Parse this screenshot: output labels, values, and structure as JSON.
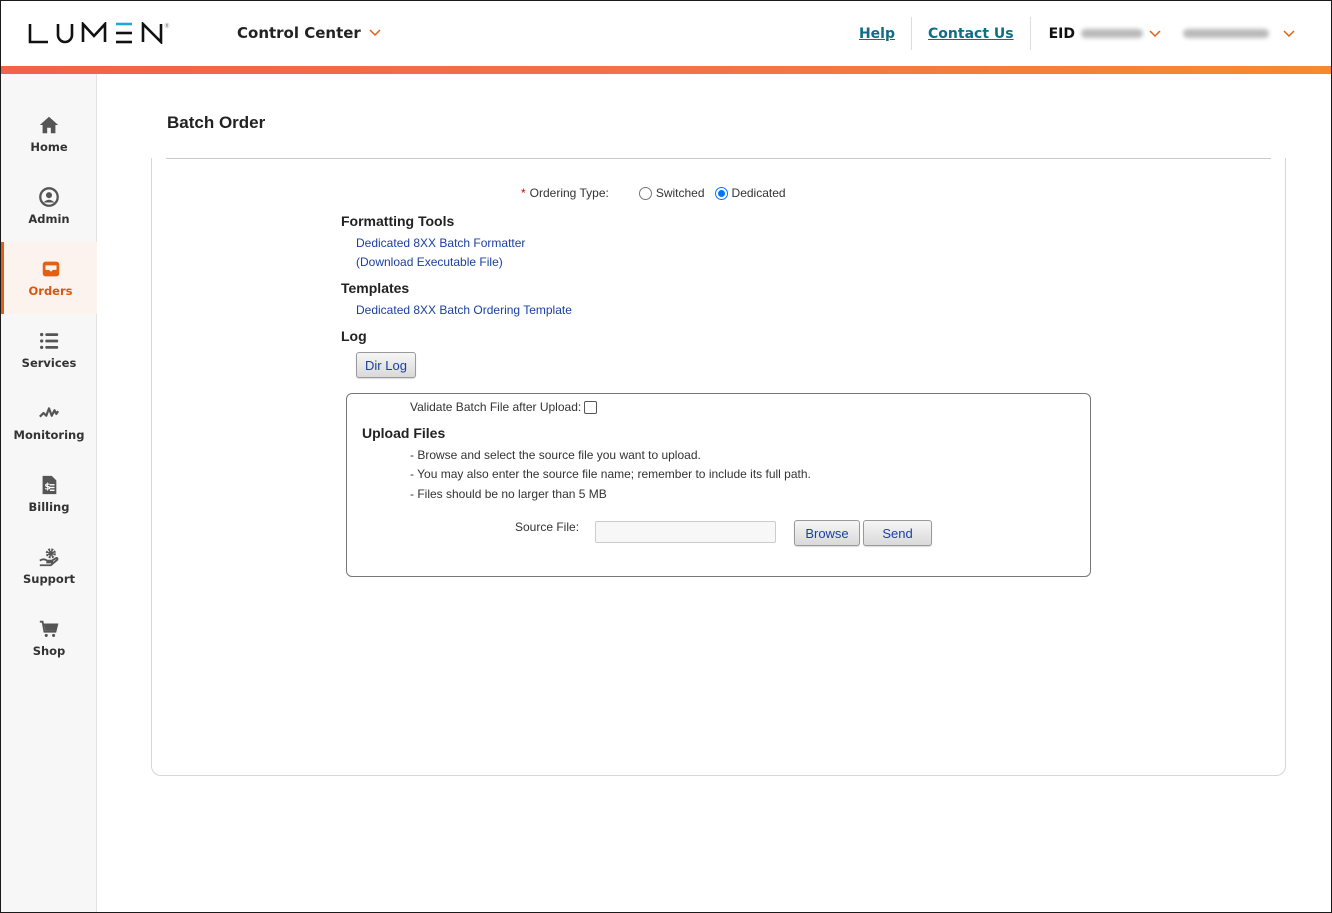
{
  "header": {
    "logo_text": "LUMEN",
    "app_switcher_label": "Control Center",
    "help_label": "Help",
    "contact_label": "Contact Us",
    "eid_label": "EID",
    "eid_value": "[redacted]",
    "user_name": "[redacted]"
  },
  "colors": {
    "accent": "#e35f12",
    "link": "#1a3fa0",
    "header_link": "#0e6e84",
    "gradient_start": "#f4604a",
    "gradient_end": "#f78a31"
  },
  "sidebar": {
    "items": [
      {
        "label": "Home",
        "icon": "home-icon",
        "active": false
      },
      {
        "label": "Admin",
        "icon": "user-circle-icon",
        "active": false
      },
      {
        "label": "Orders",
        "icon": "inbox-tray-icon",
        "active": true
      },
      {
        "label": "Services",
        "icon": "list-icon",
        "active": false
      },
      {
        "label": "Monitoring",
        "icon": "pulse-icon",
        "active": false
      },
      {
        "label": "Billing",
        "icon": "invoice-dollar-icon",
        "active": false
      },
      {
        "label": "Support",
        "icon": "hand-gear-icon",
        "active": false
      },
      {
        "label": "Shop",
        "icon": "cart-icon",
        "active": false
      }
    ]
  },
  "main": {
    "title": "Batch Order",
    "ordering_type": {
      "required_marker": "*",
      "label": "Ordering Type:",
      "options": [
        {
          "label": "Switched",
          "selected": false
        },
        {
          "label": "Dedicated",
          "selected": true
        }
      ]
    },
    "formatting_tools": {
      "heading": "Formatting Tools",
      "link1": "Dedicated 8XX Batch Formatter",
      "link2": "(Download Executable File)"
    },
    "templates": {
      "heading": "Templates",
      "link": "Dedicated 8XX Batch Ordering Template"
    },
    "log": {
      "heading": "Log",
      "button": "Dir Log"
    },
    "upload": {
      "validate_label": "Validate Batch File after Upload:",
      "validate_checked": false,
      "heading": "Upload Files",
      "instructions": [
        "- Browse and select the source file you want to upload.",
        "- You may also enter the source file name; remember to include its full path.",
        "- Files should be no larger than 5 MB"
      ],
      "source_label": "Source File:",
      "source_value": "",
      "browse_button": "Browse",
      "send_button": "Send"
    }
  }
}
